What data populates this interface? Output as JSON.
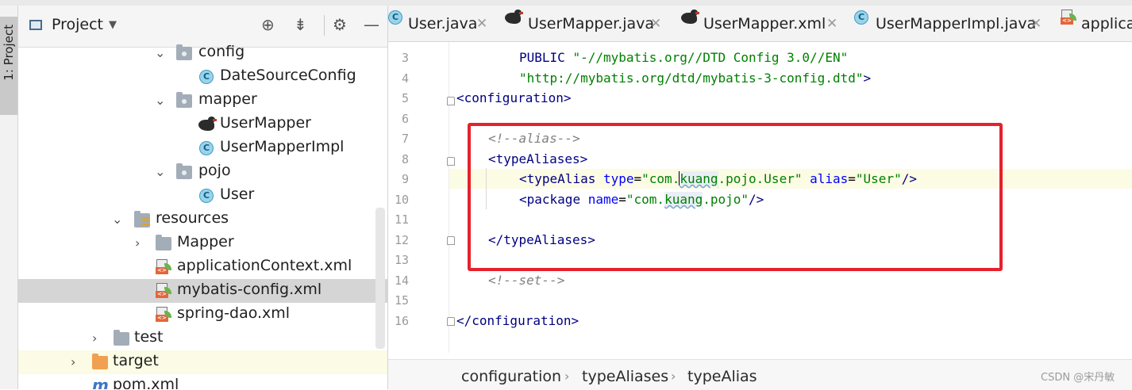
{
  "toolstrip": {
    "project_tab": "1: Project"
  },
  "project_panel": {
    "title": "Project",
    "tree": [
      {
        "label": "config",
        "kind": "package",
        "expanded": true
      },
      {
        "label": "DateSourceConfig",
        "kind": "class"
      },
      {
        "label": "mapper",
        "kind": "package",
        "expanded": true
      },
      {
        "label": "UserMapper",
        "kind": "mybatis-mapper"
      },
      {
        "label": "UserMapperImpl",
        "kind": "class"
      },
      {
        "label": "pojo",
        "kind": "package",
        "expanded": true
      },
      {
        "label": "User",
        "kind": "class"
      },
      {
        "label": "resources",
        "kind": "resources-folder",
        "expanded": true
      },
      {
        "label": "Mapper",
        "kind": "folder",
        "expanded": false
      },
      {
        "label": "applicationContext.xml",
        "kind": "spring-xml"
      },
      {
        "label": "mybatis-config.xml",
        "kind": "spring-xml",
        "selected": true
      },
      {
        "label": "spring-dao.xml",
        "kind": "spring-xml"
      },
      {
        "label": "test",
        "kind": "folder",
        "expanded": false
      },
      {
        "label": "target",
        "kind": "excluded-folder",
        "expanded": false
      },
      {
        "label": "pom.xml",
        "kind": "maven",
        "icon_text": "m"
      }
    ]
  },
  "tabs": [
    {
      "label": "User.java",
      "icon": "class-icon",
      "class_letter": "C"
    },
    {
      "label": "UserMapper.java",
      "icon": "mybatis-bird-icon"
    },
    {
      "label": "UserMapper.xml",
      "icon": "mybatis-bird-icon"
    },
    {
      "label": "UserMapperImpl.java",
      "icon": "class-icon",
      "class_letter": "C"
    },
    {
      "label": "applica",
      "icon": "spring-xml-icon"
    }
  ],
  "editor": {
    "line_numbers": [
      "3",
      "4",
      "5",
      "6",
      "7",
      "8",
      "9",
      "10",
      "11",
      "12",
      "13",
      "14",
      "15",
      "16"
    ],
    "lines": {
      "l3": {
        "kw": "PUBLIC ",
        "str": "\"-//mybatis.org//DTD Config 3.0//EN\""
      },
      "l4": {
        "str": "\"http://mybatis.org/dtd/mybatis-3-config.dtd\"",
        "end": ">"
      },
      "l5": {
        "open": "<",
        "tag": "configuration",
        "close": ">"
      },
      "l7": {
        "comment": "<!--alias-->"
      },
      "l8": {
        "open": "<",
        "tag": "typeAliases",
        "close": ">"
      },
      "l9": {
        "open": "<",
        "tag": "typeAlias",
        "attr1": " type",
        "eq1": "=",
        "val1a": "\"com.",
        "val1b": "kuang",
        "val1c": ".pojo.User\"",
        "attr2": " alias",
        "eq2": "=",
        "val2": "\"User\"",
        "close": "/>"
      },
      "l10": {
        "open": "<",
        "tag": "package",
        "attr1": " name",
        "eq1": "=",
        "val1a": "\"com.",
        "val1b": "kuang",
        "val1c": ".pojo\"",
        "close": "/>"
      },
      "l12": {
        "open": "</",
        "tag": "typeAliases",
        "close": ">"
      },
      "l14": {
        "comment": "<!--set-->"
      },
      "l16": {
        "open": "</",
        "tag": "configuration",
        "close": ">"
      }
    }
  },
  "breadcrumb": [
    "configuration",
    "typeAliases",
    "typeAlias"
  ],
  "watermark": "CSDN @宋丹敏",
  "colors": {
    "highlight_box": "#e5212b",
    "xml_tag": "#000080",
    "xml_attr": "#0000ff",
    "xml_string": "#008000",
    "comment": "#808080",
    "selected_row": "#d5d5d5"
  }
}
